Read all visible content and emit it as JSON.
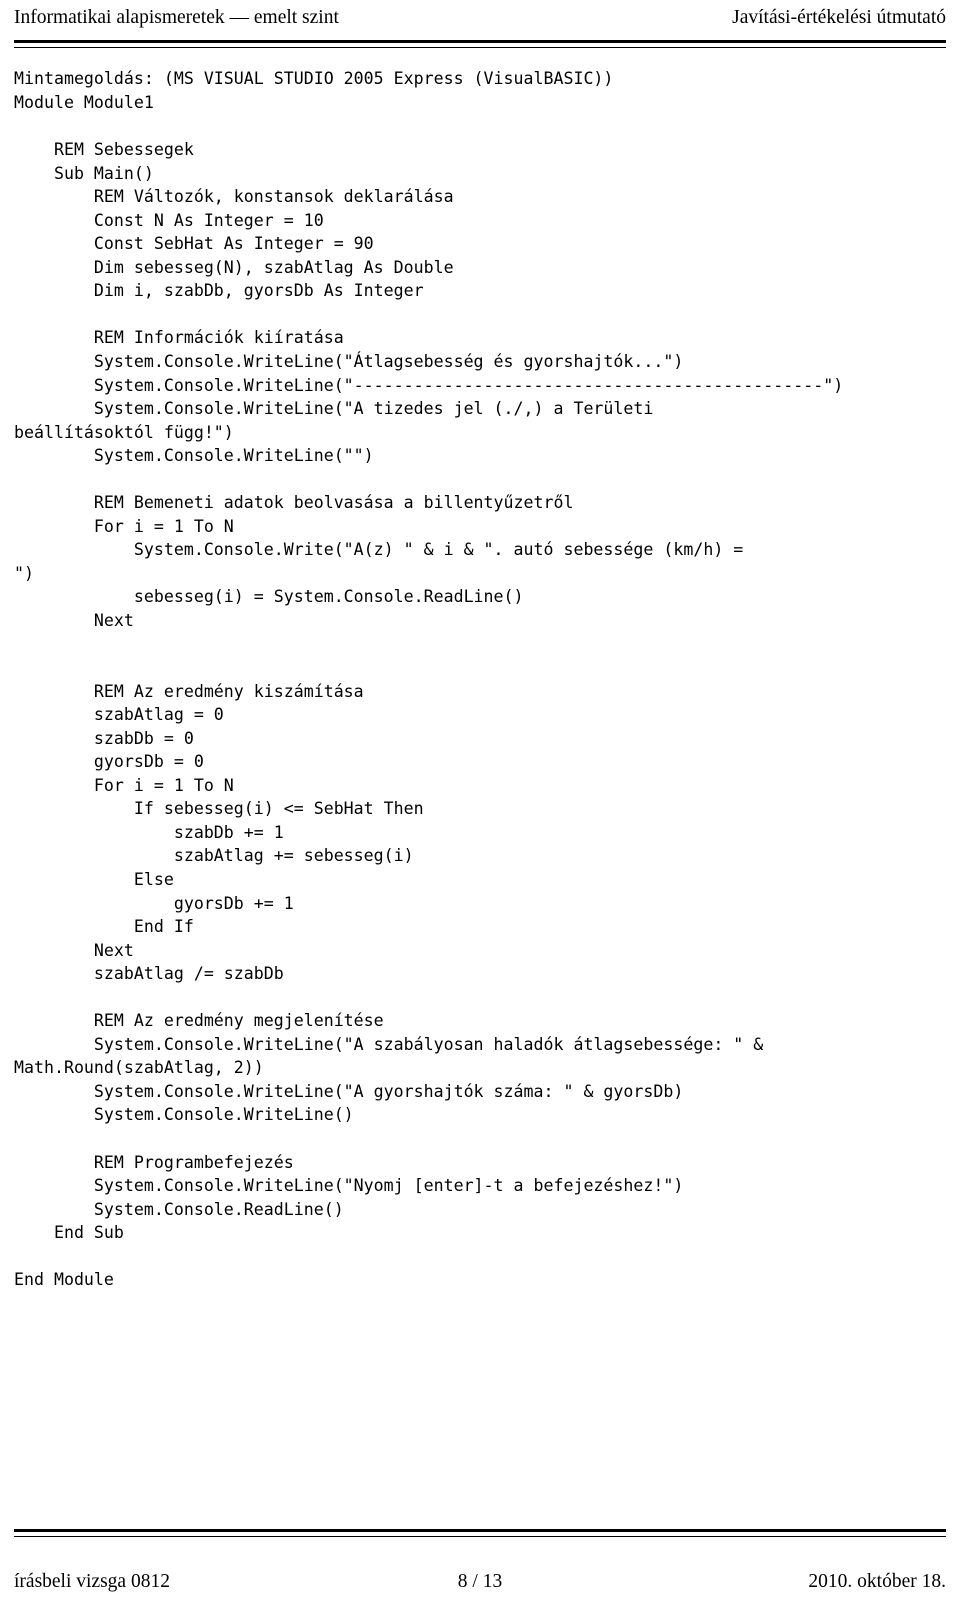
{
  "header": {
    "left": "Informatikai alapismeretek — emelt szint",
    "right": "Javítási-értékelési útmutató"
  },
  "footer": {
    "left": "írásbeli vizsga 0812",
    "center": "8 / 13",
    "right": "2010. október 18."
  },
  "code": {
    "language": "VisualBASIC",
    "lines": [
      "Mintamegoldás: (MS VISUAL STUDIO 2005 Express (VisualBASIC))",
      "Module Module1",
      "",
      "    REM Sebessegek",
      "    Sub Main()",
      "        REM Változók, konstansok deklarálása",
      "        Const N As Integer = 10",
      "        Const SebHat As Integer = 90",
      "        Dim sebesseg(N), szabAtlag As Double",
      "        Dim i, szabDb, gyorsDb As Integer",
      "",
      "        REM Információk kiíratása",
      "        System.Console.WriteLine(\"Átlagsebesség és gyorshajtók...\")",
      "        System.Console.WriteLine(\"-----------------------------------------------\")",
      "        System.Console.WriteLine(\"A tizedes jel (./,) a Területi",
      "beállításoktól függ!\")",
      "        System.Console.WriteLine(\"\")",
      "",
      "        REM Bemeneti adatok beolvasása a billentyűzetről",
      "        For i = 1 To N",
      "            System.Console.Write(\"A(z) \" & i & \". autó sebessége (km/h) =",
      "\")",
      "            sebesseg(i) = System.Console.ReadLine()",
      "        Next",
      "",
      "",
      "        REM Az eredmény kiszámítása",
      "        szabAtlag = 0",
      "        szabDb = 0",
      "        gyorsDb = 0",
      "        For i = 1 To N",
      "            If sebesseg(i) <= SebHat Then",
      "                szabDb += 1",
      "                szabAtlag += sebesseg(i)",
      "            Else",
      "                gyorsDb += 1",
      "            End If",
      "        Next",
      "        szabAtlag /= szabDb",
      "",
      "        REM Az eredmény megjelenítése",
      "        System.Console.WriteLine(\"A szabályosan haladók átlagsebessége: \" &",
      "Math.Round(szabAtlag, 2))",
      "        System.Console.WriteLine(\"A gyorshajtók száma: \" & gyorsDb)",
      "        System.Console.WriteLine()",
      "",
      "        REM Programbefejezés",
      "        System.Console.WriteLine(\"Nyomj [enter]-t a befejezéshez!\")",
      "        System.Console.ReadLine()",
      "    End Sub",
      "",
      "End Module"
    ]
  }
}
